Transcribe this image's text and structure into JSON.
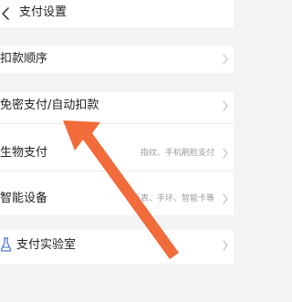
{
  "header": {
    "title": "支付设置",
    "back_icon": "chevron-left-icon"
  },
  "rows": {
    "deduction_order": {
      "label": "扣款顺序"
    },
    "auto_pay": {
      "label": "免密支付/自动扣款"
    },
    "biometric": {
      "label": "生物支付",
      "value": "指纹、手机刷脸支付"
    },
    "smart_device": {
      "label": "智能设备",
      "value": "手表、手环、智能卡等"
    },
    "lab": {
      "label": "支付实验室",
      "icon": "flask-icon"
    }
  },
  "colors": {
    "background": "#f4f4f4",
    "card": "#ffffff",
    "text": "#222222",
    "secondary_text": "#999999",
    "chevron": "#c4c4c4",
    "lab_icon": "#4a7bd1",
    "annotation_arrow": "#f26b3a"
  },
  "annotation": {
    "icon": "pointer-arrow-icon",
    "target": "免密支付/自动扣款"
  }
}
